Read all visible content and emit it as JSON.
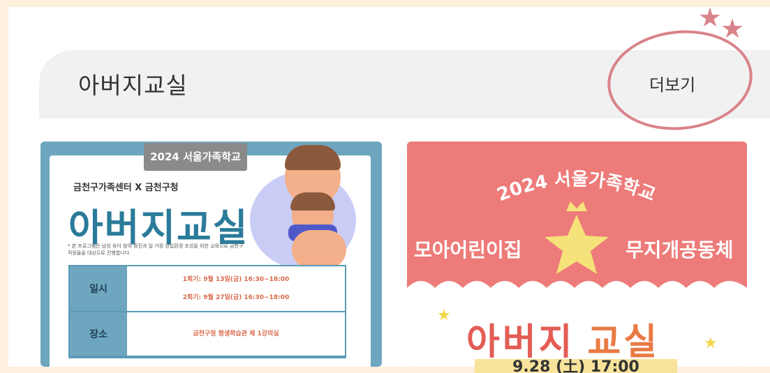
{
  "section": {
    "title": "아버지교실",
    "more_label": "더보기"
  },
  "card1": {
    "banner": "2024 서울가족학교",
    "org": "금천구가족센터 X 금천구청",
    "title": "아버지교실",
    "description": "* 본 프로그램은 남성 육아 참여 증진과 일·가정 양립환경 조성을 위한 교육으로 금천구 직원들을 대상으로 진행합니다.",
    "table": [
      {
        "label": "일시",
        "values": [
          "1회기: 9월 13일(금) 16:30~18:00",
          "2회기: 9월 27일(금) 16:30~18:00"
        ]
      },
      {
        "label": "장소",
        "values": [
          "금천구청 평생학습관 제 1강의실"
        ]
      }
    ]
  },
  "card2": {
    "arc_text": "2024 서울가족학교",
    "left_text": "모아어린이집",
    "right_text": "무지개공동체",
    "big_part1": "아버지",
    "big_part2": "교실",
    "date_fragment": "9.28 (土) 17:00"
  },
  "colors": {
    "page_bg": "#fdf0dc",
    "accent_circle": "#d9838a",
    "card1_blue": "#6ea6bf",
    "card2_red": "#ed7b79"
  }
}
